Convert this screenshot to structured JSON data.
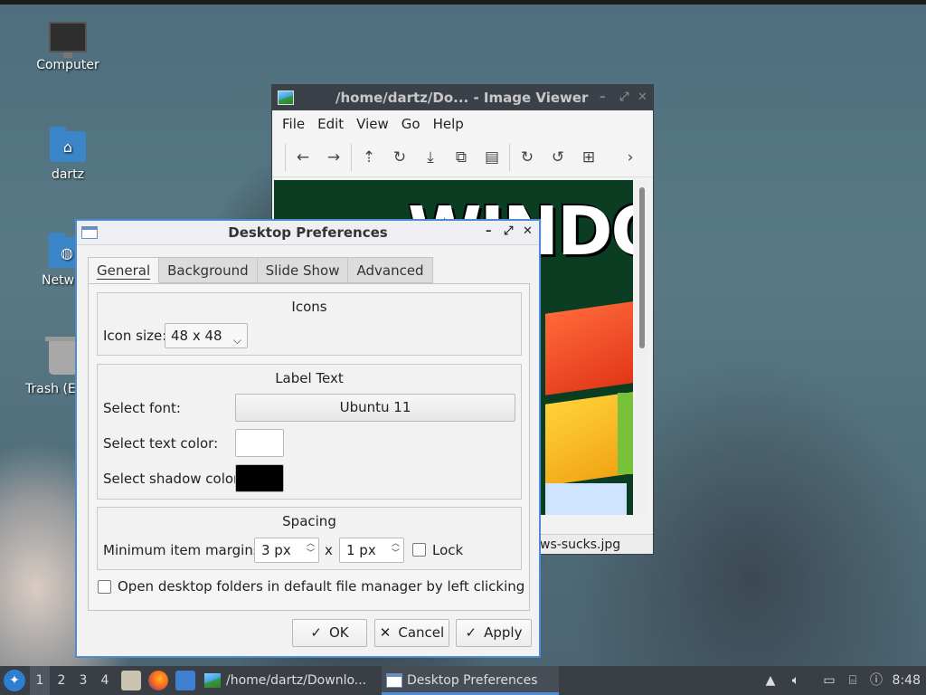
{
  "desktop": {
    "icons": [
      {
        "label": "Computer"
      },
      {
        "label": "dartz"
      },
      {
        "label": "Netw"
      },
      {
        "label": "Trash (E"
      }
    ]
  },
  "viewer": {
    "title": "/home/dartz/Do...  - Image Viewer",
    "menu": [
      "File",
      "Edit",
      "View",
      "Go",
      "Help"
    ],
    "image_text": "WINDO",
    "status_filename": "ws-sucks.jpg"
  },
  "prefs": {
    "title": "Desktop Preferences",
    "tabs": [
      "General",
      "Background",
      "Slide Show",
      "Advanced"
    ],
    "icons_frame": {
      "title": "Icons",
      "icon_size_label": "Icon size:",
      "icon_size_value": "48 x 48"
    },
    "label_frame": {
      "title": "Label Text",
      "font_label": "Select font:",
      "font_value": "Ubuntu 11",
      "text_color_label": "Select text color:",
      "text_color": "#ffffff",
      "shadow_color_label": "Select shadow color:",
      "shadow_color": "#000000"
    },
    "spacing_frame": {
      "title": "Spacing",
      "margins_label": "Minimum item margins:",
      "margin_x": "3 px",
      "separator": "x",
      "margin_y": "1 px",
      "lock_label": "Lock"
    },
    "open_folders_label": "Open desktop folders in default file manager by left clicking",
    "buttons": {
      "ok": "OK",
      "cancel": "Cancel",
      "apply": "Apply"
    }
  },
  "taskbar": {
    "workspaces": [
      "1",
      "2",
      "3",
      "4"
    ],
    "tasks": [
      {
        "label": "/home/dartz/Downlo..."
      },
      {
        "label": "Desktop Preferences"
      }
    ],
    "clock": "8:48"
  },
  "colors": {
    "accent": "#4f8bd2",
    "taskbar": "#3a3f46"
  }
}
